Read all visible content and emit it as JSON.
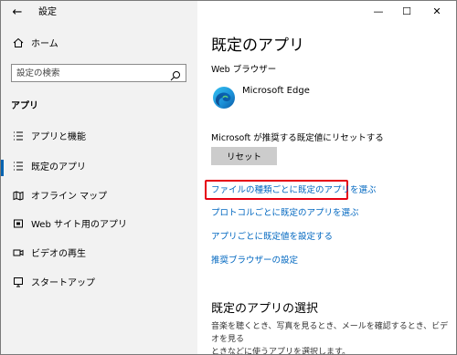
{
  "window": {
    "title": "設定"
  },
  "sidebar": {
    "home_label": "ホーム",
    "search_placeholder": "設定の検索",
    "section_label": "アプリ",
    "items": [
      {
        "label": "アプリと機能",
        "icon": "list-icon"
      },
      {
        "label": "既定のアプリ",
        "icon": "default-apps-icon",
        "selected": true
      },
      {
        "label": "オフライン マップ",
        "icon": "offline-map-icon"
      },
      {
        "label": "Web サイト用のアプリ",
        "icon": "website-apps-icon"
      },
      {
        "label": "ビデオの再生",
        "icon": "video-icon"
      },
      {
        "label": "スタートアップ",
        "icon": "startup-icon"
      }
    ]
  },
  "main": {
    "title": "既定のアプリ",
    "browser_label": "Web ブラウザー",
    "browser_name": "Microsoft Edge",
    "reset_desc": "Microsoft が推奨する既定値にリセットする",
    "reset_button": "リセット",
    "links": [
      "ファイルの種類ごとに既定のアプリを選ぶ",
      "プロトコルごとに既定のアプリを選ぶ",
      "アプリごとに既定値を設定する",
      "推奨ブラウザーの設定"
    ],
    "section_title": "既定のアプリの選択",
    "section_desc_line1": "音楽を聴くとき、写真を見るとき、メールを確認するとき、ビデオを見る",
    "section_desc_line2": "ときなどに使うアプリを選択します。"
  },
  "colors": {
    "accent": "#0063b1",
    "link": "#0067c0",
    "highlight": "#e60012",
    "sidebar_bg": "#f2f2f2"
  }
}
